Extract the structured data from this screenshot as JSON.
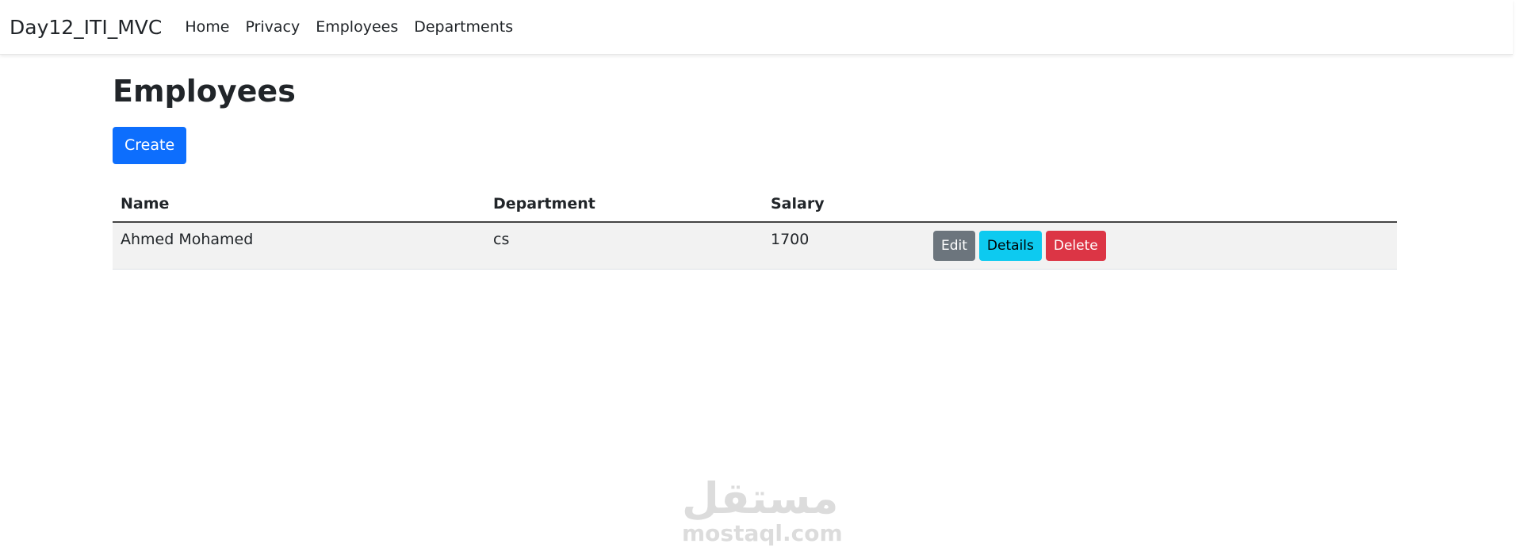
{
  "navbar": {
    "brand": "Day12_ITI_MVC",
    "links": [
      "Home",
      "Privacy",
      "Employees",
      "Departments"
    ]
  },
  "main": {
    "title": "Employees",
    "create_label": "Create",
    "table": {
      "headers": [
        "Name",
        "Department",
        "Salary"
      ],
      "rows": [
        {
          "name": "Ahmed Mohamed",
          "department": "cs",
          "salary": "1700",
          "actions": [
            "Edit",
            "Details",
            "Delete"
          ]
        }
      ]
    }
  },
  "watermark": {
    "arabic": "مستقل",
    "latin": "mostaql.com"
  },
  "colors": {
    "primary": "#0d6efd",
    "secondary": "#6c757d",
    "info": "#0dcaf0",
    "danger": "#dc3545"
  }
}
